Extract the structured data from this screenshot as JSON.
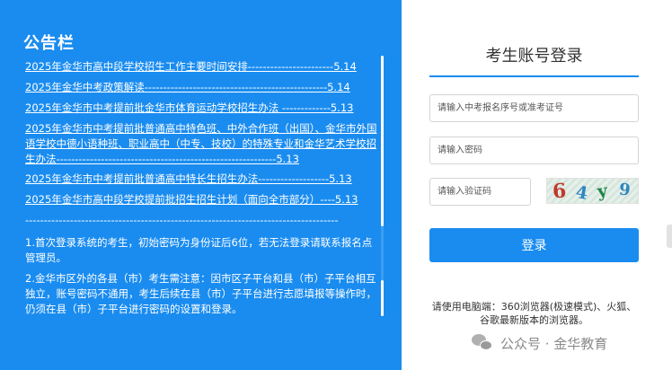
{
  "notice": {
    "title": "公告栏",
    "items": [
      "2025年金华市高中段学校招生工作主要时间安排-----------------------5.14",
      "2025年金华中考政策解读-------------------------------------------------5.14",
      "2025年金华市中考提前批金华市体育运动学校招生办法 -------------5.13",
      "2025年金华市中考提前批普通高中特色班、中外合作班（出国）、金华市外国语学校中德小语种班、职业高中（中专、技校）的特殊专业和金华艺术学校招生办法-----------------------------------------------------------5.13",
      "2025年金华市中考提前批普通高中特长生招生办法-------------------5.13",
      "2025年金华市高中段学校提前批招生招生计划（面向全市部分）----5.13"
    ],
    "divider": "------------------------------------------------------------------------------------",
    "notes": [
      "1.首次登录系统的考生，初始密码为身份证后6位，若无法登录请联系报名点管理员。",
      "2.金华市区外的各县（市）考生需注意：因市区子平台和县（市）子平台相互独立，账号密码不通用，考生后续在县（市）子平台进行志愿填报等操作时，仍须在县（市）子平台进行密码的设置和登录。"
    ]
  },
  "login": {
    "title": "考生账号登录",
    "username_placeholder": "请输入中考报名序号或准考证号",
    "password_placeholder": "请输入密码",
    "captcha_placeholder": "请输入验证码",
    "captcha_chars": [
      {
        "char": "6",
        "color": "#c0392b"
      },
      {
        "char": "4",
        "color": "#2e86c1"
      },
      {
        "char": "y",
        "color": "#1e8449"
      },
      {
        "char": "9",
        "color": "#2e86c1"
      }
    ],
    "submit_label": "登录",
    "browser_tip": "请使用电脑端：360浏览器(极速模式)、火狐、谷歌最新版本的浏览器。"
  },
  "watermark": {
    "text": "公众号 · 金华教育",
    "icon": "wechat-icon"
  },
  "colors": {
    "accent": "#1a8cf0",
    "text": "#333333"
  }
}
